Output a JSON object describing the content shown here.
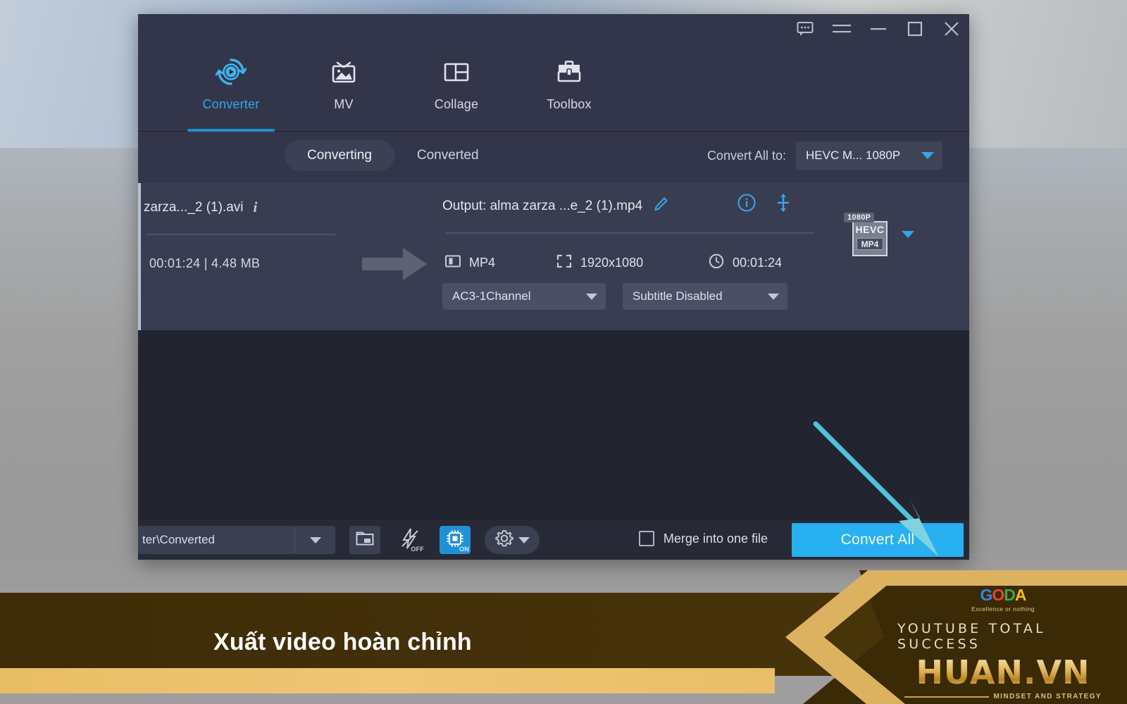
{
  "window": {
    "controls": [
      {
        "name": "feedback",
        "icon": "speech-bubble-icon"
      },
      {
        "name": "menu",
        "icon": "hamburger-menu-icon"
      },
      {
        "name": "minimize",
        "icon": "minimize-icon"
      },
      {
        "name": "maximize",
        "icon": "maximize-icon"
      },
      {
        "name": "close",
        "icon": "close-icon"
      }
    ]
  },
  "nav": {
    "tabs": [
      {
        "label": "Converter",
        "icon": "converter-icon",
        "active": true
      },
      {
        "label": "MV",
        "icon": "mv-icon",
        "active": false
      },
      {
        "label": "Collage",
        "icon": "collage-icon",
        "active": false
      },
      {
        "label": "Toolbox",
        "icon": "toolbox-icon",
        "active": false
      }
    ]
  },
  "subbar": {
    "segments": [
      {
        "label": "Converting",
        "selected": true
      },
      {
        "label": "Converted",
        "selected": false
      }
    ],
    "convert_all_to_label": "Convert All to:",
    "convert_all_to_value": "HEVC M... 1080P"
  },
  "file_item": {
    "source_name": "zarza..._2 (1).avi",
    "source_duration": "00:01:24",
    "source_size": "4.48 MB",
    "source_meta": "00:01:24 | 4.48 MB",
    "output_label": "Output: alma zarza ...e_2 (1).mp4",
    "format": "MP4",
    "resolution": "1920x1080",
    "duration": "00:01:24",
    "audio_track": "AC3-1Channel",
    "subtitle_track": "Subtitle Disabled",
    "badge_resolution": "1080P",
    "badge_codec": "HEVC",
    "badge_container": "MP4"
  },
  "bottombar": {
    "output_path": "ter\\Converted",
    "tools": [
      {
        "name": "open-folder",
        "icon": "folder-icon"
      },
      {
        "name": "high-speed-conversion",
        "icon": "lightning-bolt-icon",
        "state": "OFF"
      },
      {
        "name": "gpu-acceleration",
        "icon": "gpu-chip-icon",
        "state": "ON"
      },
      {
        "name": "settings",
        "icon": "gear-icon"
      }
    ],
    "merge_label": "Merge into one file",
    "merge_checked": false,
    "convert_all_label": "Convert All"
  },
  "banner": {
    "caption": "Xuất video hoàn chỉnh",
    "brand_logo": "GODA",
    "brand_letters": [
      "G",
      "O",
      "D",
      "A"
    ],
    "brand_tagline": "Excellence or nothing",
    "brand_line1": "YOUTUBE TOTAL SUCCESS",
    "brand_line2": "HUAN.VN",
    "brand_line3": "MINDSET AND STRATEGY"
  },
  "colors": {
    "accent_blue": "#2fa8e8",
    "convert_button": "#29b0f1",
    "arrow_teal": "#4fc3d9",
    "window_bg": "#2b2d3a",
    "panel_bg": "#33364a",
    "row_bg": "#393d51",
    "list_bg": "#22242f",
    "banner_brown": "#43300a",
    "banner_gold": "#e8bd64"
  }
}
